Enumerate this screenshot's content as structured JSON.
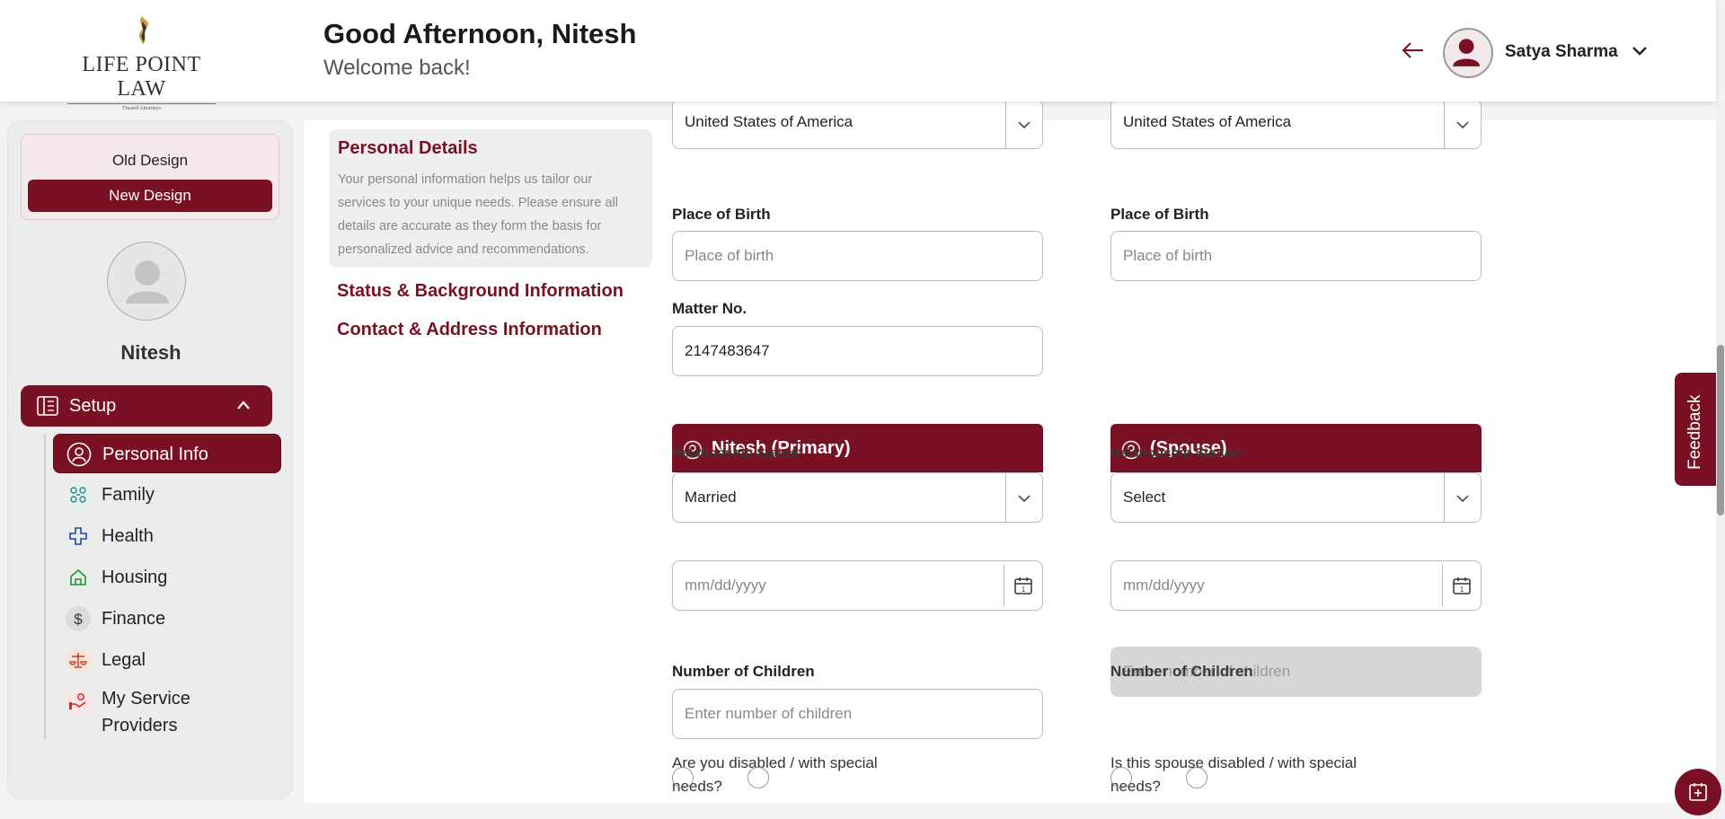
{
  "brand": {
    "name": "LIFE POINT LAW",
    "tagline": "Trusted Attorneys",
    "color": "#7a1024"
  },
  "header": {
    "greeting": "Good Afternoon, Nitesh",
    "subtitle": "Welcome back!",
    "user_name": "Satya Sharma"
  },
  "sidebar": {
    "old_design": "Old Design",
    "new_design": "New Design",
    "profile_name": "Nitesh",
    "setup_label": "Setup",
    "items": [
      {
        "label": "Personal Info",
        "icon": "user-circle-icon",
        "active": true
      },
      {
        "label": "Family",
        "icon": "family-tree-icon"
      },
      {
        "label": "Health",
        "icon": "health-cross-icon"
      },
      {
        "label": "Housing",
        "icon": "house-icon"
      },
      {
        "label": "Finance",
        "icon": "dollar-icon"
      },
      {
        "label": "Legal",
        "icon": "scales-icon"
      },
      {
        "label": "My Service Providers",
        "label_line1": "My Service",
        "label_line2": "Providers",
        "icon": "handshake-icon"
      }
    ]
  },
  "sections": {
    "personal_details_title": "Personal Details",
    "personal_details_desc": "Your personal information helps us tailor our services to your unique needs. Please ensure all details are accurate as they form the basis for personalized advice and recommendations.",
    "status_link": "Status & Background Information",
    "contact_link": "Contact & Address Information"
  },
  "form": {
    "primary": {
      "country_value": "United States of America",
      "place_of_birth_label": "Place of Birth",
      "place_of_birth_placeholder": "Place of birth",
      "matter_no_label": "Matter No.",
      "matter_no_value": "2147483647",
      "header": "Nitesh (Primary)",
      "relationship_label": "Relationship Status*",
      "relationship_value": "Married",
      "date_placeholder": "mm/dd/yyyy",
      "children_label": "Number of Children",
      "children_placeholder": "Enter number of children",
      "disabled_question": "Are you disabled / with special needs?"
    },
    "spouse": {
      "country_value": "United States of America",
      "place_of_birth_label": "Place of Birth",
      "place_of_birth_placeholder": "Place of birth",
      "header": "(Spouse)",
      "relationship_label": "Relationship Status*",
      "relationship_value": "Select",
      "date_placeholder": "mm/dd/yyyy",
      "children_label": "Number of Children",
      "children_placeholder": "Enter number of children",
      "disabled_question": "Is this spouse disabled / with special needs?"
    }
  },
  "feedback_label": "Feedback"
}
